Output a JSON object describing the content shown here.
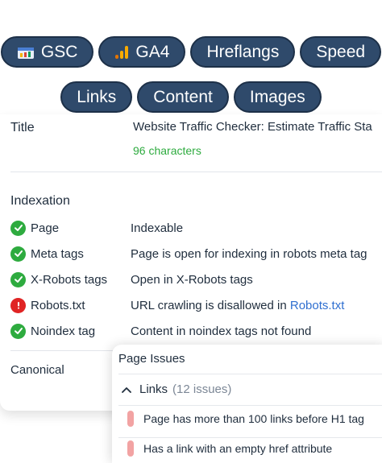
{
  "tabs": [
    {
      "label": "GSC",
      "icon": "google-search-console-icon"
    },
    {
      "label": "GA4",
      "icon": "analytics-bars-icon"
    },
    {
      "label": "Hreflangs"
    },
    {
      "label": "Speed"
    },
    {
      "label": "Links"
    },
    {
      "label": "Content"
    },
    {
      "label": "Images"
    }
  ],
  "title_section": {
    "label": "Title",
    "value": "Website Traffic Checker: Estimate Traffic Sta",
    "count": "96 characters"
  },
  "indexation": {
    "heading": "Indexation",
    "rows": [
      {
        "name": "Page",
        "value": "Indexable",
        "status": "ok"
      },
      {
        "name": "Meta tags",
        "value": "Page is open for indexing in robots meta tag",
        "status": "ok"
      },
      {
        "name": "X-Robots tags",
        "value": "Open in X-Robots tags",
        "status": "ok"
      },
      {
        "name": "Robots.txt",
        "value": "URL crawling is disallowed in ",
        "link": "Robots.txt",
        "status": "error"
      },
      {
        "name": "Noindex tag",
        "value": "Content in noindex tags not found",
        "status": "ok"
      }
    ]
  },
  "canonical": {
    "label": "Canonical"
  },
  "page_issues": {
    "title": "Page Issues",
    "group_label": "Links",
    "group_count": "(12 issues)",
    "items": [
      "Page has more than 100 links before H1 tag",
      "Has a link with an empty href attribute"
    ]
  },
  "colors": {
    "pill_bg": "#2f4a6b",
    "ok_green": "#2eab3f",
    "error_red": "#e02424",
    "issue_bar": "#f2a3a3",
    "link_blue": "#2f6fd0"
  }
}
